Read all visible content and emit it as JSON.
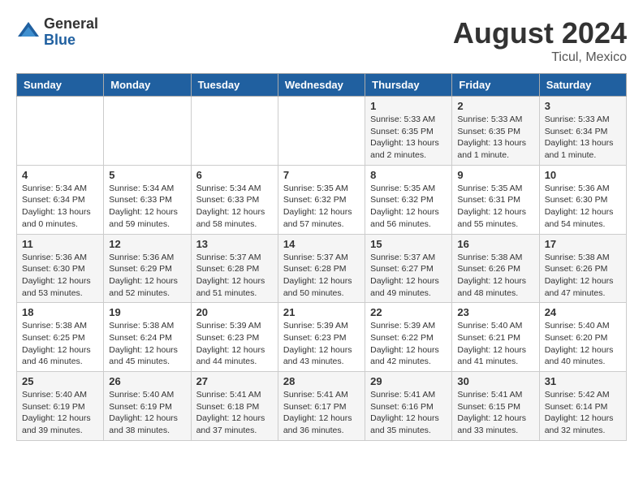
{
  "header": {
    "logo_general": "General",
    "logo_blue": "Blue",
    "month_year": "August 2024",
    "location": "Ticul, Mexico"
  },
  "weekdays": [
    "Sunday",
    "Monday",
    "Tuesday",
    "Wednesday",
    "Thursday",
    "Friday",
    "Saturday"
  ],
  "weeks": [
    [
      {
        "day": "",
        "info": ""
      },
      {
        "day": "",
        "info": ""
      },
      {
        "day": "",
        "info": ""
      },
      {
        "day": "",
        "info": ""
      },
      {
        "day": "1",
        "info": "Sunrise: 5:33 AM\nSunset: 6:35 PM\nDaylight: 13 hours\nand 2 minutes."
      },
      {
        "day": "2",
        "info": "Sunrise: 5:33 AM\nSunset: 6:35 PM\nDaylight: 13 hours\nand 1 minute."
      },
      {
        "day": "3",
        "info": "Sunrise: 5:33 AM\nSunset: 6:34 PM\nDaylight: 13 hours\nand 1 minute."
      }
    ],
    [
      {
        "day": "4",
        "info": "Sunrise: 5:34 AM\nSunset: 6:34 PM\nDaylight: 13 hours\nand 0 minutes."
      },
      {
        "day": "5",
        "info": "Sunrise: 5:34 AM\nSunset: 6:33 PM\nDaylight: 12 hours\nand 59 minutes."
      },
      {
        "day": "6",
        "info": "Sunrise: 5:34 AM\nSunset: 6:33 PM\nDaylight: 12 hours\nand 58 minutes."
      },
      {
        "day": "7",
        "info": "Sunrise: 5:35 AM\nSunset: 6:32 PM\nDaylight: 12 hours\nand 57 minutes."
      },
      {
        "day": "8",
        "info": "Sunrise: 5:35 AM\nSunset: 6:32 PM\nDaylight: 12 hours\nand 56 minutes."
      },
      {
        "day": "9",
        "info": "Sunrise: 5:35 AM\nSunset: 6:31 PM\nDaylight: 12 hours\nand 55 minutes."
      },
      {
        "day": "10",
        "info": "Sunrise: 5:36 AM\nSunset: 6:30 PM\nDaylight: 12 hours\nand 54 minutes."
      }
    ],
    [
      {
        "day": "11",
        "info": "Sunrise: 5:36 AM\nSunset: 6:30 PM\nDaylight: 12 hours\nand 53 minutes."
      },
      {
        "day": "12",
        "info": "Sunrise: 5:36 AM\nSunset: 6:29 PM\nDaylight: 12 hours\nand 52 minutes."
      },
      {
        "day": "13",
        "info": "Sunrise: 5:37 AM\nSunset: 6:28 PM\nDaylight: 12 hours\nand 51 minutes."
      },
      {
        "day": "14",
        "info": "Sunrise: 5:37 AM\nSunset: 6:28 PM\nDaylight: 12 hours\nand 50 minutes."
      },
      {
        "day": "15",
        "info": "Sunrise: 5:37 AM\nSunset: 6:27 PM\nDaylight: 12 hours\nand 49 minutes."
      },
      {
        "day": "16",
        "info": "Sunrise: 5:38 AM\nSunset: 6:26 PM\nDaylight: 12 hours\nand 48 minutes."
      },
      {
        "day": "17",
        "info": "Sunrise: 5:38 AM\nSunset: 6:26 PM\nDaylight: 12 hours\nand 47 minutes."
      }
    ],
    [
      {
        "day": "18",
        "info": "Sunrise: 5:38 AM\nSunset: 6:25 PM\nDaylight: 12 hours\nand 46 minutes."
      },
      {
        "day": "19",
        "info": "Sunrise: 5:38 AM\nSunset: 6:24 PM\nDaylight: 12 hours\nand 45 minutes."
      },
      {
        "day": "20",
        "info": "Sunrise: 5:39 AM\nSunset: 6:23 PM\nDaylight: 12 hours\nand 44 minutes."
      },
      {
        "day": "21",
        "info": "Sunrise: 5:39 AM\nSunset: 6:23 PM\nDaylight: 12 hours\nand 43 minutes."
      },
      {
        "day": "22",
        "info": "Sunrise: 5:39 AM\nSunset: 6:22 PM\nDaylight: 12 hours\nand 42 minutes."
      },
      {
        "day": "23",
        "info": "Sunrise: 5:40 AM\nSunset: 6:21 PM\nDaylight: 12 hours\nand 41 minutes."
      },
      {
        "day": "24",
        "info": "Sunrise: 5:40 AM\nSunset: 6:20 PM\nDaylight: 12 hours\nand 40 minutes."
      }
    ],
    [
      {
        "day": "25",
        "info": "Sunrise: 5:40 AM\nSunset: 6:19 PM\nDaylight: 12 hours\nand 39 minutes."
      },
      {
        "day": "26",
        "info": "Sunrise: 5:40 AM\nSunset: 6:19 PM\nDaylight: 12 hours\nand 38 minutes."
      },
      {
        "day": "27",
        "info": "Sunrise: 5:41 AM\nSunset: 6:18 PM\nDaylight: 12 hours\nand 37 minutes."
      },
      {
        "day": "28",
        "info": "Sunrise: 5:41 AM\nSunset: 6:17 PM\nDaylight: 12 hours\nand 36 minutes."
      },
      {
        "day": "29",
        "info": "Sunrise: 5:41 AM\nSunset: 6:16 PM\nDaylight: 12 hours\nand 35 minutes."
      },
      {
        "day": "30",
        "info": "Sunrise: 5:41 AM\nSunset: 6:15 PM\nDaylight: 12 hours\nand 33 minutes."
      },
      {
        "day": "31",
        "info": "Sunrise: 5:42 AM\nSunset: 6:14 PM\nDaylight: 12 hours\nand 32 minutes."
      }
    ]
  ]
}
